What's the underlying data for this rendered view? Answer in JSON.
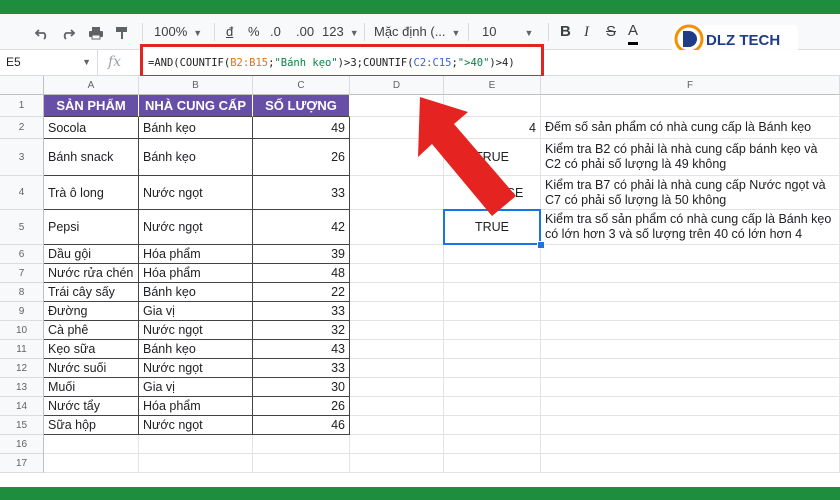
{
  "toolbar": {
    "zoom": "100%",
    "currency": "đ",
    "percent": "%",
    "decimal_decrease": ".0",
    "decimal_increase": ".00",
    "number_format": "123",
    "font": "Mặc định (...",
    "font_size": "10",
    "bold": "B",
    "italic": "I",
    "strikethrough": "S",
    "text_color": "A"
  },
  "logo": {
    "text": "DLZ TECH"
  },
  "formula_bar": {
    "name_box": "E5",
    "fx": "fx",
    "p1": "=AND(COUNTIF(",
    "r1": "B2:B15",
    "p2": ";",
    "s1": "\"Bánh kẹo\"",
    "p3": ")>3;COUNTIF(",
    "r2": "C2:C15",
    "p4": ";",
    "s2": "\">40\"",
    "p5": ")>4)"
  },
  "columns": [
    "A",
    "B",
    "C",
    "D",
    "E",
    "F"
  ],
  "rows": [
    "1",
    "2",
    "3",
    "4",
    "5",
    "6",
    "7",
    "8",
    "9",
    "10",
    "11",
    "12",
    "13",
    "14",
    "15",
    "16",
    "17"
  ],
  "table": {
    "headers": [
      "SẢN PHẨM",
      "NHÀ CUNG CẤP",
      "SỐ LƯỢNG"
    ],
    "data": [
      [
        "Socola",
        "Bánh kẹo",
        "49"
      ],
      [
        "Bánh snack",
        "Bánh kẹo",
        "26"
      ],
      [
        "Trà ô long",
        "Nước ngọt",
        "33"
      ],
      [
        "Pepsi",
        "Nước ngọt",
        "42"
      ],
      [
        "Dầu gội",
        "Hóa phẩm",
        "39"
      ],
      [
        "Nước rửa chén",
        "Hóa phẩm",
        "48"
      ],
      [
        "Trái cây sấy",
        "Bánh kẹo",
        "22"
      ],
      [
        "Đường",
        "Gia vị",
        "33"
      ],
      [
        "Cà phê",
        "Nước ngọt",
        "32"
      ],
      [
        "Kẹo sữa",
        "Bánh kẹo",
        "43"
      ],
      [
        "Nước suối",
        "Nước ngọt",
        "33"
      ],
      [
        "Muối",
        "Gia vị",
        "30"
      ],
      [
        "Nước tẩy",
        "Hóa phẩm",
        "26"
      ],
      [
        "Sữa hộp",
        "Nước ngọt",
        "46"
      ]
    ]
  },
  "results": {
    "e2": "4",
    "e3": "TRUE",
    "e4": "SE",
    "e5": "TRUE"
  },
  "notes": {
    "f2": "Đếm số sản phẩm có nhà cung cấp là Bánh kẹo",
    "f3": "Kiểm tra B2 có phải là nhà cung cấp bánh kẹo và C2 có phải số lượng là 49 không",
    "f4": "Kiểm tra B7 có phải là nhà cung cấp Nước ngọt và C7 có phải số lượng là 50 không",
    "f5": "Kiểm tra số sản phẩm có nhà cung cấp là Bánh kẹo có lớn hơn 3 và số lượng trên 40 có lớn hơn 4"
  },
  "colors": {
    "header_bg": "#674ea7",
    "highlight": "#e52421",
    "selection": "#1a73e8",
    "frame": "#1e8e3e"
  }
}
